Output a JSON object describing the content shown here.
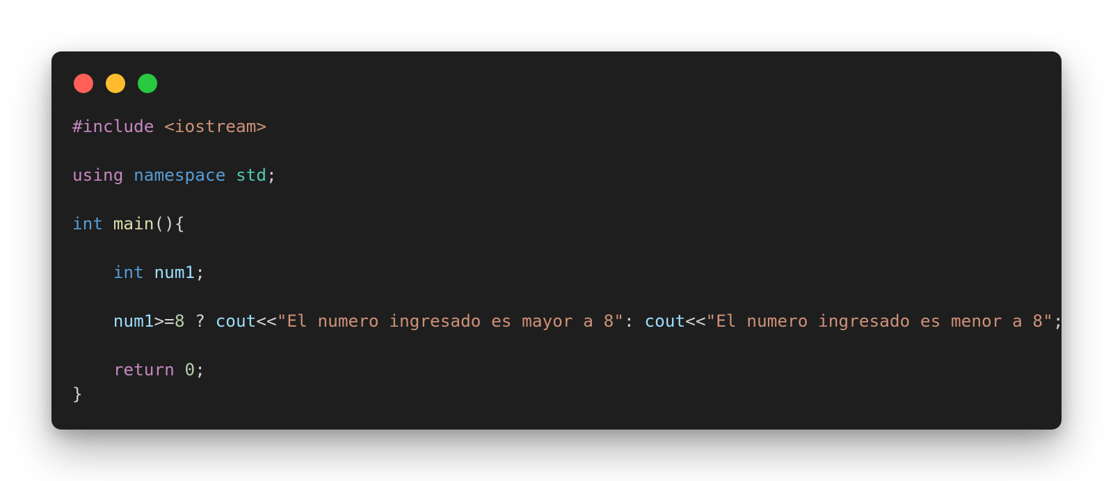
{
  "window": {
    "controls": [
      {
        "name": "close",
        "color": "#ff5f57"
      },
      {
        "name": "minimize",
        "color": "#febc2e"
      },
      {
        "name": "zoom",
        "color": "#28c840"
      }
    ]
  },
  "theme": {
    "keyword_purple": "#c586c0",
    "keyword_blue": "#569cd6",
    "type_teal": "#4ec9b0",
    "function_yellow": "#dcdcaa",
    "variable_blue": "#9cdcfe",
    "string_orange": "#ce9178",
    "number_green": "#b5cea8",
    "default_text": "#d4d4d4"
  },
  "code": {
    "lines": [
      [
        {
          "text": "#include",
          "color": "#c586c0"
        },
        {
          "text": " ",
          "color": "#d4d4d4"
        },
        {
          "text": "<iostream>",
          "color": "#ce9178"
        }
      ],
      [],
      [
        {
          "text": "using",
          "color": "#c586c0"
        },
        {
          "text": " ",
          "color": "#d4d4d4"
        },
        {
          "text": "namespace",
          "color": "#569cd6"
        },
        {
          "text": " ",
          "color": "#d4d4d4"
        },
        {
          "text": "std",
          "color": "#4ec9b0"
        },
        {
          "text": ";",
          "color": "#d4d4d4"
        }
      ],
      [],
      [
        {
          "text": "int",
          "color": "#569cd6"
        },
        {
          "text": " ",
          "color": "#d4d4d4"
        },
        {
          "text": "main",
          "color": "#dcdcaa"
        },
        {
          "text": "(){",
          "color": "#d4d4d4"
        }
      ],
      [],
      [
        {
          "text": "    ",
          "color": "#d4d4d4"
        },
        {
          "text": "int",
          "color": "#569cd6"
        },
        {
          "text": " ",
          "color": "#d4d4d4"
        },
        {
          "text": "num1",
          "color": "#9cdcfe"
        },
        {
          "text": ";",
          "color": "#d4d4d4"
        }
      ],
      [],
      [
        {
          "text": "    ",
          "color": "#d4d4d4"
        },
        {
          "text": "num1",
          "color": "#9cdcfe"
        },
        {
          "text": ">=",
          "color": "#d4d4d4"
        },
        {
          "text": "8",
          "color": "#b5cea8"
        },
        {
          "text": " ? ",
          "color": "#d4d4d4"
        },
        {
          "text": "cout",
          "color": "#9cdcfe"
        },
        {
          "text": "<<",
          "color": "#d4d4d4"
        },
        {
          "text": "\"El numero ingresado es mayor a 8\"",
          "color": "#ce9178"
        },
        {
          "text": ": ",
          "color": "#d4d4d4"
        },
        {
          "text": "cout",
          "color": "#9cdcfe"
        },
        {
          "text": "<<",
          "color": "#d4d4d4"
        },
        {
          "text": "\"El numero ingresado es menor a 8\"",
          "color": "#ce9178"
        },
        {
          "text": ";",
          "color": "#d4d4d4"
        }
      ],
      [],
      [
        {
          "text": "    ",
          "color": "#d4d4d4"
        },
        {
          "text": "return",
          "color": "#c586c0"
        },
        {
          "text": " ",
          "color": "#d4d4d4"
        },
        {
          "text": "0",
          "color": "#b5cea8"
        },
        {
          "text": ";",
          "color": "#d4d4d4"
        }
      ],
      [
        {
          "text": "}",
          "color": "#d4d4d4"
        }
      ]
    ]
  }
}
